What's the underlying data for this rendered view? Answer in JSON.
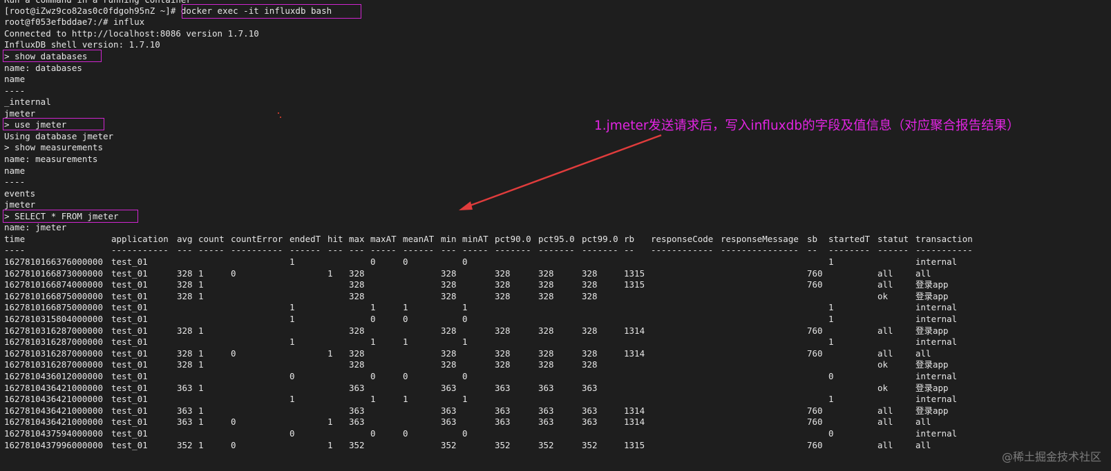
{
  "colors": {
    "background": "#1e1e1e",
    "text": "#e6e6e6",
    "highlight_box": "#d126d1",
    "annotation": "#e225e2",
    "arrow": "#e03c3c"
  },
  "terminal": {
    "lines": [
      "Run a command in a running container",
      "[root@iZwz9co82as0c0fdgoh95nZ ~]# docker exec -it influxdb bash",
      "root@f053efbddae7:/# influx",
      "Connected to http://localhost:8086 version 1.7.10",
      "InfluxDB shell version: 1.7.10",
      "> show databases",
      "name: databases",
      "name",
      "----",
      "_internal",
      "jmeter",
      "> use jmeter",
      "Using database jmeter",
      "> show measurements",
      "name: measurements",
      "name",
      "----",
      "events",
      "jmeter",
      "> SELECT * FROM jmeter",
      "name: jmeter"
    ],
    "table": {
      "columns": [
        "time",
        "application",
        "avg",
        "count",
        "countError",
        "endedT",
        "hit",
        "max",
        "maxAT",
        "meanAT",
        "min",
        "minAT",
        "pct90.0",
        "pct95.0",
        "pct99.0",
        "rb",
        "responseCode",
        "responseMessage",
        "sb",
        "startedT",
        "statut",
        "transaction"
      ],
      "dashes": [
        "----",
        "-----------",
        "---",
        "-----",
        "----------",
        "------",
        "---",
        "---",
        "-----",
        "------",
        "---",
        "-----",
        "-------",
        "-------",
        "-------",
        "--",
        "------------",
        "---------------",
        "--",
        "--------",
        "------",
        "-----------"
      ],
      "rows": [
        [
          "1627810166376000000",
          "test_01",
          "",
          "",
          "",
          "1",
          "",
          "",
          "0",
          "0",
          "",
          "0",
          "",
          "",
          "",
          "",
          "",
          "",
          "",
          "1",
          "",
          "internal"
        ],
        [
          "1627810166873000000",
          "test_01",
          "328",
          "1",
          "0",
          "",
          "1",
          "328",
          "",
          "",
          "328",
          "",
          "328",
          "328",
          "328",
          "1315",
          "",
          "",
          "760",
          "",
          "all",
          "all"
        ],
        [
          "1627810166874000000",
          "test_01",
          "328",
          "1",
          "",
          "",
          "",
          "328",
          "",
          "",
          "328",
          "",
          "328",
          "328",
          "328",
          "1315",
          "",
          "",
          "760",
          "",
          "all",
          "登录app"
        ],
        [
          "1627810166875000000",
          "test_01",
          "328",
          "1",
          "",
          "",
          "",
          "328",
          "",
          "",
          "328",
          "",
          "328",
          "328",
          "328",
          "",
          "",
          "",
          "",
          "",
          "ok",
          "登录app"
        ],
        [
          "1627810166875000000",
          "test_01",
          "",
          "",
          "",
          "1",
          "",
          "",
          "1",
          "1",
          "",
          "1",
          "",
          "",
          "",
          "",
          "",
          "",
          "",
          "1",
          "",
          "internal"
        ],
        [
          "1627810315804000000",
          "test_01",
          "",
          "",
          "",
          "1",
          "",
          "",
          "0",
          "0",
          "",
          "0",
          "",
          "",
          "",
          "",
          "",
          "",
          "",
          "1",
          "",
          "internal"
        ],
        [
          "1627810316287000000",
          "test_01",
          "328",
          "1",
          "",
          "",
          "",
          "328",
          "",
          "",
          "328",
          "",
          "328",
          "328",
          "328",
          "1314",
          "",
          "",
          "760",
          "",
          "all",
          "登录app"
        ],
        [
          "1627810316287000000",
          "test_01",
          "",
          "",
          "",
          "1",
          "",
          "",
          "1",
          "1",
          "",
          "1",
          "",
          "",
          "",
          "",
          "",
          "",
          "",
          "1",
          "",
          "internal"
        ],
        [
          "1627810316287000000",
          "test_01",
          "328",
          "1",
          "0",
          "",
          "1",
          "328",
          "",
          "",
          "328",
          "",
          "328",
          "328",
          "328",
          "1314",
          "",
          "",
          "760",
          "",
          "all",
          "all"
        ],
        [
          "1627810316287000000",
          "test_01",
          "328",
          "1",
          "",
          "",
          "",
          "328",
          "",
          "",
          "328",
          "",
          "328",
          "328",
          "328",
          "",
          "",
          "",
          "",
          "",
          "ok",
          "登录app"
        ],
        [
          "1627810436012000000",
          "test_01",
          "",
          "",
          "",
          "0",
          "",
          "",
          "0",
          "0",
          "",
          "0",
          "",
          "",
          "",
          "",
          "",
          "",
          "",
          "0",
          "",
          "internal"
        ],
        [
          "1627810436421000000",
          "test_01",
          "363",
          "1",
          "",
          "",
          "",
          "363",
          "",
          "",
          "363",
          "",
          "363",
          "363",
          "363",
          "",
          "",
          "",
          "",
          "",
          "ok",
          "登录app"
        ],
        [
          "1627810436421000000",
          "test_01",
          "",
          "",
          "",
          "1",
          "",
          "",
          "1",
          "1",
          "",
          "1",
          "",
          "",
          "",
          "",
          "",
          "",
          "",
          "1",
          "",
          "internal"
        ],
        [
          "1627810436421000000",
          "test_01",
          "363",
          "1",
          "",
          "",
          "",
          "363",
          "",
          "",
          "363",
          "",
          "363",
          "363",
          "363",
          "1314",
          "",
          "",
          "760",
          "",
          "all",
          "登录app"
        ],
        [
          "1627810436421000000",
          "test_01",
          "363",
          "1",
          "0",
          "",
          "1",
          "363",
          "",
          "",
          "363",
          "",
          "363",
          "363",
          "363",
          "1314",
          "",
          "",
          "760",
          "",
          "all",
          "all"
        ],
        [
          "1627810437594000000",
          "test_01",
          "",
          "",
          "",
          "0",
          "",
          "",
          "0",
          "0",
          "",
          "0",
          "",
          "",
          "",
          "",
          "",
          "",
          "",
          "0",
          "",
          "internal"
        ],
        [
          "1627810437996000000",
          "test_01",
          "352",
          "1",
          "0",
          "",
          "1",
          "352",
          "",
          "",
          "352",
          "",
          "352",
          "352",
          "352",
          "1315",
          "",
          "",
          "760",
          "",
          "all",
          "all"
        ]
      ]
    }
  },
  "annotation": {
    "text": "1.jmeter发送请求后，写入influxdb的字段及值信息（对应聚合报告结果）",
    "icon": "arrow-icon"
  },
  "watermark": "@稀土掘金技术社区"
}
